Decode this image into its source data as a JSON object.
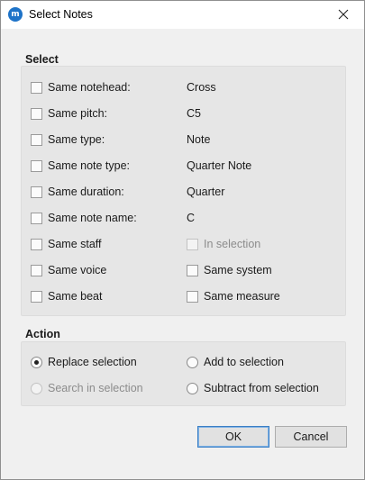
{
  "window": {
    "title": "Select Notes",
    "icon": "musescore-icon",
    "close_icon": "close-icon"
  },
  "select_group": {
    "title": "Select",
    "rows": [
      {
        "label": "Same notehead:",
        "value": "Cross",
        "checked": false
      },
      {
        "label": "Same pitch:",
        "value": "C5",
        "checked": false
      },
      {
        "label": "Same type:",
        "value": "Note",
        "checked": false
      },
      {
        "label": "Same note type:",
        "value": "Quarter Note",
        "checked": false
      },
      {
        "label": "Same duration:",
        "value": "Quarter",
        "checked": false
      },
      {
        "label": "Same note name:",
        "value": "C",
        "checked": false
      }
    ],
    "pairs": [
      {
        "left": "Same staff",
        "right": "In selection",
        "right_disabled": true
      },
      {
        "left": "Same voice",
        "right": "Same system",
        "right_disabled": false
      },
      {
        "left": "Same beat",
        "right": "Same measure",
        "right_disabled": false
      }
    ]
  },
  "action_group": {
    "title": "Action",
    "options": [
      {
        "label": "Replace selection",
        "checked": true,
        "disabled": false
      },
      {
        "label": "Add to selection",
        "checked": false,
        "disabled": false
      },
      {
        "label": "Search in selection",
        "checked": false,
        "disabled": true
      },
      {
        "label": "Subtract from selection",
        "checked": false,
        "disabled": false
      }
    ]
  },
  "buttons": {
    "ok": "OK",
    "cancel": "Cancel"
  }
}
